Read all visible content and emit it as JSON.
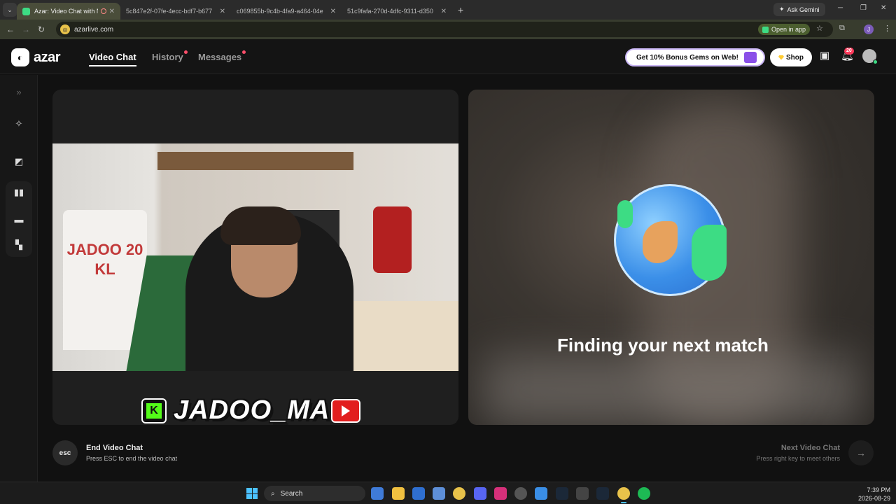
{
  "browser": {
    "tabs": [
      {
        "title": "Azar: Video Chat with New",
        "active": true
      },
      {
        "title": "5c847e2f-07fe-4ecc-bdf7-b677",
        "active": false
      },
      {
        "title": "c069855b-9c4b-4fa9-a464-04e",
        "active": false
      },
      {
        "title": "51c9fafa-270d-4dfc-9311-d350",
        "active": false
      }
    ],
    "ask_gemini": "Ask Gemini",
    "url": "azarlive.com",
    "open_in_app": "Open in app",
    "profile_initial": "J"
  },
  "app": {
    "logo_text": "azar",
    "nav": {
      "video_chat": "Video Chat",
      "history": "History",
      "messages": "Messages"
    },
    "promo": "Get 10% Bonus Gems on Web!",
    "shop": "Shop",
    "notifications_count": "20"
  },
  "left_panel": {
    "shirt_text": "JADOO 20 KL",
    "overlay_name": "JADOO_MA",
    "kick_letter": "K"
  },
  "right_panel": {
    "status": "Finding your next match"
  },
  "footer": {
    "esc_label": "esc",
    "end_title": "End Video Chat",
    "end_sub": "Press ESC to end the video chat",
    "next_title": "Next Video Chat",
    "next_sub": "Press right key to meet others"
  },
  "taskbar": {
    "search": "Search",
    "time": "7:39 PM",
    "date": "2026-08-29"
  },
  "colors": {
    "accent_green": "#3ddc84",
    "notification_red": "#ff3b5c",
    "promo_purple": "#8a4fe8"
  }
}
